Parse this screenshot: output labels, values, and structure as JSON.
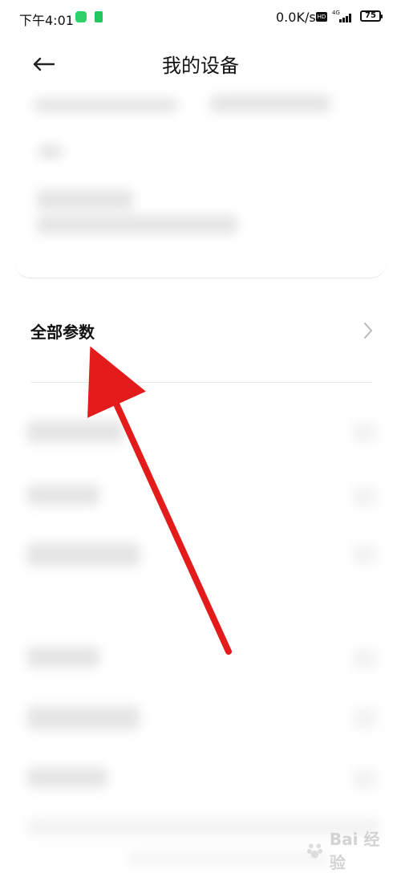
{
  "status_bar": {
    "time": "下午4:01",
    "network_speed": "0.0K/s",
    "hd_label": "HD",
    "signal_label": "4G",
    "battery_level": "75",
    "icons": [
      "app-notification-icon",
      "app-notification-icon-2",
      "hd-icon",
      "signal-icon",
      "battery-icon"
    ]
  },
  "header": {
    "title": "我的设备",
    "back_icon": "arrow-left-icon"
  },
  "main": {
    "all_params": {
      "label": "全部参数",
      "icon": "chevron-right-icon"
    }
  },
  "annotation": {
    "arrow_color": "#e31b1b"
  },
  "watermark": {
    "text": "Bai 经验"
  }
}
